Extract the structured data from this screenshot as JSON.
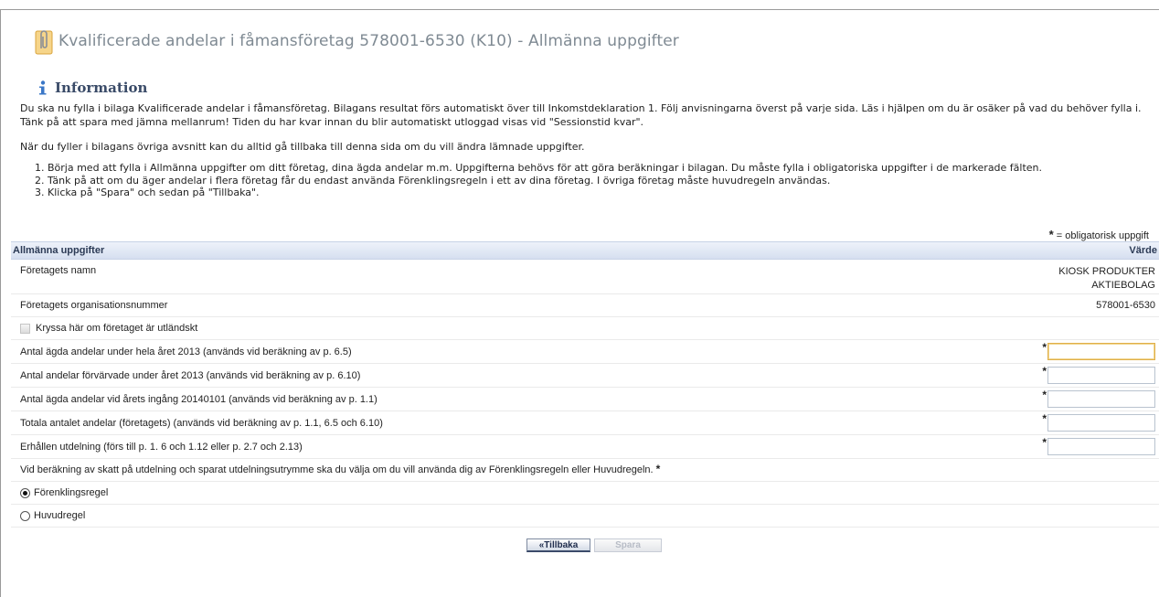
{
  "header": {
    "title": "Kvalificerade andelar i fåmansföretag 578001-6530 (K10) - Allmänna uppgifter"
  },
  "info": {
    "heading": "Information",
    "paragraph1": "Du ska nu fylla i bilaga Kvalificerade andelar i fåmansföretag. Bilagans resultat förs automatiskt över till Inkomstdeklaration 1. Följ anvisningarna överst på varje sida. Läs i hjälpen om du är osäker på vad du behöver fylla i. Tänk på att spara med jämna mellanrum! Tiden du har kvar innan du blir automatiskt utloggad visas vid \"Sessionstid kvar\".",
    "paragraph2": "När du fyller i bilagans övriga avsnitt kan du alltid gå tillbaka till denna sida om du vill ändra lämnade uppgifter.",
    "steps": [
      "Börja med att fylla i Allmänna uppgifter om ditt företag, dina ägda andelar m.m. Uppgifterna behövs för att göra beräkningar i bilagan. Du måste fylla i obligatoriska uppgifter i de markerade fälten.",
      "Tänk på att om du äger andelar i flera företag får du endast använda Förenklingsregeln i ett av dina företag. I övriga företag måste huvudregeln användas.",
      "Klicka på \"Spara\" och sedan på \"Tillbaka\"."
    ]
  },
  "required_note": {
    "star": "*",
    "text": " = obligatorisk uppgift"
  },
  "table": {
    "header_left": "Allmänna uppgifter",
    "header_right": "Värde",
    "company_name_label": "Företagets namn",
    "company_name_line1": "KIOSK PRODUKTER",
    "company_name_line2": "AKTIEBOLAG",
    "org_number_label": "Företagets organisationsnummer",
    "org_number_value": "578001-6530",
    "foreign_checkbox_label": "Kryssa här om företaget är utländskt",
    "fields": [
      {
        "label": "Antal ägda andelar under hela året 2013 (används vid beräkning av p. 6.5)",
        "value": ""
      },
      {
        "label": "Antal andelar förvärvade under året 2013 (används vid beräkning av p. 6.10)",
        "value": ""
      },
      {
        "label": "Antal ägda andelar vid årets ingång 20140101 (används vid beräkning av p. 1.1)",
        "value": ""
      },
      {
        "label": "Totala antalet andelar (företagets) (används vid beräkning av p. 1.1, 6.5 och 6.10)",
        "value": ""
      },
      {
        "label": "Erhållen utdelning (förs till p. 1. 6 och 1.12 eller p. 2.7 och 2.13)",
        "value": ""
      }
    ],
    "rule_question": "Vid beräkning av skatt på utdelning och sparat utdelningsutrymme ska du välja om du vill använda dig av Förenklingsregeln eller Huvudregeln.",
    "rule_question_star": "*",
    "radio_simplified": "Förenklingsregel",
    "radio_main": "Huvudregel",
    "selected_rule": "Förenklingsregel"
  },
  "buttons": {
    "back_label": "«Tillbaka",
    "save_label": "Spara"
  },
  "colors": {
    "title": "#7f8a93",
    "info_heading": "#3a4b68",
    "table_header": "#d6dff0",
    "focus_border": "#e0b04a"
  },
  "icons": {
    "title_icon": "paperclip-icon",
    "info_icon": "info-icon"
  }
}
